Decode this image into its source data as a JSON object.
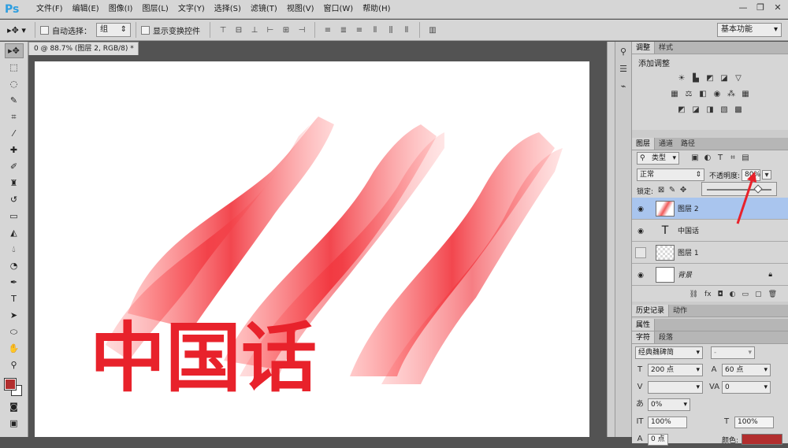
{
  "app": {
    "logo": "Ps"
  },
  "menu": [
    "文件(F)",
    "编辑(E)",
    "图像(I)",
    "图层(L)",
    "文字(Y)",
    "选择(S)",
    "滤镜(T)",
    "视图(V)",
    "窗口(W)",
    "帮助(H)"
  ],
  "options": {
    "auto_select_label": "自动选择：",
    "auto_select_value": "组",
    "show_transform_label": "显示变换控件",
    "workspace": "基本功能"
  },
  "document": {
    "tab_title": "0 @ 88.7% (图层 2, RGB/8) *",
    "close": "×",
    "canvas_text": "中国话"
  },
  "colors": {
    "foreground": "#b22e2e",
    "background": "#ffffff",
    "accent_red": "#e8222b",
    "selection": "#a9c5ee"
  },
  "panels": {
    "adjust_tabs": [
      "调整",
      "样式"
    ],
    "adjust_title": "添加调整",
    "layer_tabs": [
      "图层",
      "通道",
      "路径"
    ],
    "filter_kind": "类型",
    "blend_mode": "正常",
    "opacity_label": "不透明度:",
    "opacity_value": "80%",
    "opacity_level": 0.8,
    "lock_label": "锁定:",
    "layers": [
      {
        "name": "图层 2",
        "visible": true,
        "selected": true
      },
      {
        "name": "中国话",
        "visible": true,
        "selected": false,
        "type": "text"
      },
      {
        "name": "图层 1",
        "visible": false,
        "selected": false
      },
      {
        "name": "背景",
        "visible": true,
        "selected": false,
        "locked": true
      }
    ],
    "history_tabs": [
      "历史记录",
      "动作"
    ],
    "props_tab": "属性",
    "char_tabs": [
      "字符",
      "段落"
    ],
    "font_family": "经典魏碑简",
    "font_style": "-",
    "font_size": "200 点",
    "leading": "60 点",
    "tracking": "0",
    "scale_field": "0%",
    "vertical_scale": "100%",
    "horizontal_scale": "100%",
    "baseline": "0 点",
    "color_label": "颜色:"
  }
}
